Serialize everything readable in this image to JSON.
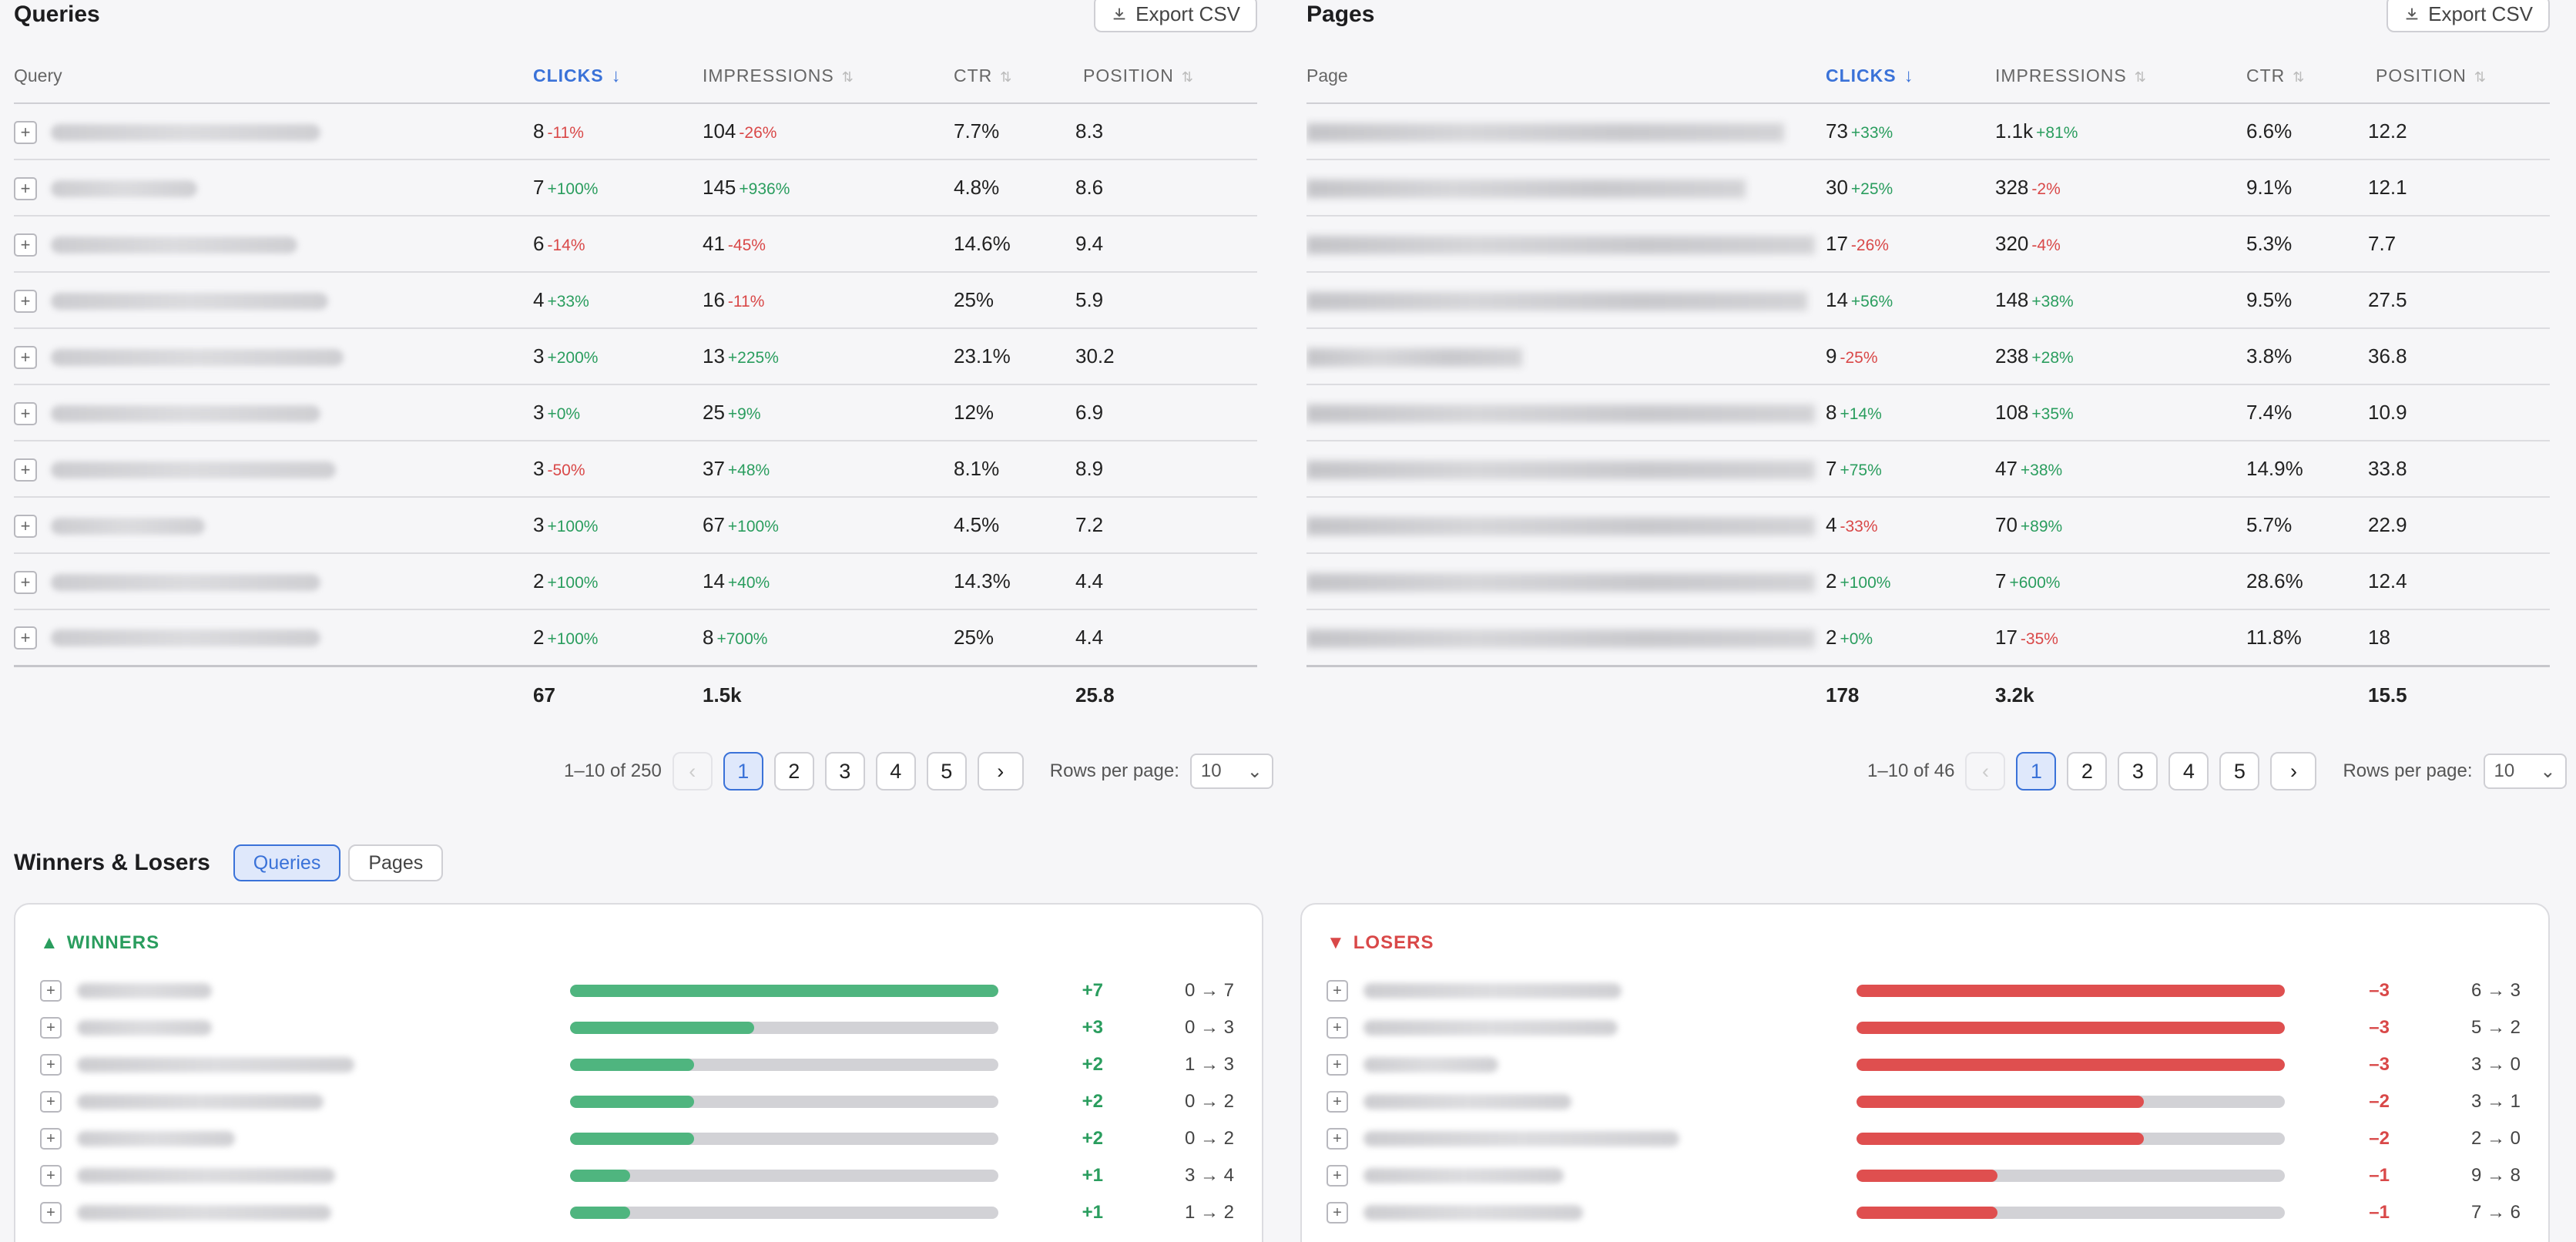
{
  "queries": {
    "title": "Queries",
    "export_label": "Export CSV",
    "columns": {
      "first": "Query",
      "clicks": "CLICKS",
      "impressions": "IMPRESSIONS",
      "ctr": "CTR",
      "position": "POSITION"
    },
    "rows": [
      {
        "clicks": "8",
        "clicks_chg": "-11%",
        "clicks_dir": "down",
        "impr": "104",
        "impr_chg": "-26%",
        "impr_dir": "down",
        "ctr": "7.7%",
        "pos": "8.3"
      },
      {
        "clicks": "7",
        "clicks_chg": "+100%",
        "clicks_dir": "up",
        "impr": "145",
        "impr_chg": "+936%",
        "impr_dir": "up",
        "ctr": "4.8%",
        "pos": "8.6"
      },
      {
        "clicks": "6",
        "clicks_chg": "-14%",
        "clicks_dir": "down",
        "impr": "41",
        "impr_chg": "-45%",
        "impr_dir": "down",
        "ctr": "14.6%",
        "pos": "9.4"
      },
      {
        "clicks": "4",
        "clicks_chg": "+33%",
        "clicks_dir": "up",
        "impr": "16",
        "impr_chg": "-11%",
        "impr_dir": "down",
        "ctr": "25%",
        "pos": "5.9"
      },
      {
        "clicks": "3",
        "clicks_chg": "+200%",
        "clicks_dir": "up",
        "impr": "13",
        "impr_chg": "+225%",
        "impr_dir": "up",
        "ctr": "23.1%",
        "pos": "30.2"
      },
      {
        "clicks": "3",
        "clicks_chg": "+0%",
        "clicks_dir": "up",
        "impr": "25",
        "impr_chg": "+9%",
        "impr_dir": "up",
        "ctr": "12%",
        "pos": "6.9"
      },
      {
        "clicks": "3",
        "clicks_chg": "-50%",
        "clicks_dir": "down",
        "impr": "37",
        "impr_chg": "+48%",
        "impr_dir": "up",
        "ctr": "8.1%",
        "pos": "8.9"
      },
      {
        "clicks": "3",
        "clicks_chg": "+100%",
        "clicks_dir": "up",
        "impr": "67",
        "impr_chg": "+100%",
        "impr_dir": "up",
        "ctr": "4.5%",
        "pos": "7.2"
      },
      {
        "clicks": "2",
        "clicks_chg": "+100%",
        "clicks_dir": "up",
        "impr": "14",
        "impr_chg": "+40%",
        "impr_dir": "up",
        "ctr": "14.3%",
        "pos": "4.4"
      },
      {
        "clicks": "2",
        "clicks_chg": "+100%",
        "clicks_dir": "up",
        "impr": "8",
        "impr_chg": "+700%",
        "impr_dir": "up",
        "ctr": "25%",
        "pos": "4.4"
      }
    ],
    "totals": {
      "clicks": "67",
      "impr": "1.5k",
      "pos": "25.8"
    },
    "pagination": {
      "range": "1–10 of 250",
      "pages": [
        "1",
        "2",
        "3",
        "4",
        "5"
      ],
      "rows_label": "Rows per page:",
      "rows_value": "10"
    }
  },
  "pages": {
    "title": "Pages",
    "export_label": "Export CSV",
    "columns": {
      "first": "Page",
      "clicks": "CLICKS",
      "impressions": "IMPRESSIONS",
      "ctr": "CTR",
      "position": "POSITION"
    },
    "rows": [
      {
        "clicks": "73",
        "clicks_chg": "+33%",
        "clicks_dir": "up",
        "impr": "1.1k",
        "impr_chg": "+81%",
        "impr_dir": "up",
        "ctr": "6.6%",
        "pos": "12.2"
      },
      {
        "clicks": "30",
        "clicks_chg": "+25%",
        "clicks_dir": "up",
        "impr": "328",
        "impr_chg": "-2%",
        "impr_dir": "down",
        "ctr": "9.1%",
        "pos": "12.1"
      },
      {
        "clicks": "17",
        "clicks_chg": "-26%",
        "clicks_dir": "down",
        "impr": "320",
        "impr_chg": "-4%",
        "impr_dir": "down",
        "ctr": "5.3%",
        "pos": "7.7"
      },
      {
        "clicks": "14",
        "clicks_chg": "+56%",
        "clicks_dir": "up",
        "impr": "148",
        "impr_chg": "+38%",
        "impr_dir": "up",
        "ctr": "9.5%",
        "pos": "27.5"
      },
      {
        "clicks": "9",
        "clicks_chg": "-25%",
        "clicks_dir": "down",
        "impr": "238",
        "impr_chg": "+28%",
        "impr_dir": "up",
        "ctr": "3.8%",
        "pos": "36.8"
      },
      {
        "clicks": "8",
        "clicks_chg": "+14%",
        "clicks_dir": "up",
        "impr": "108",
        "impr_chg": "+35%",
        "impr_dir": "up",
        "ctr": "7.4%",
        "pos": "10.9"
      },
      {
        "clicks": "7",
        "clicks_chg": "+75%",
        "clicks_dir": "up",
        "impr": "47",
        "impr_chg": "+38%",
        "impr_dir": "up",
        "ctr": "14.9%",
        "pos": "33.8"
      },
      {
        "clicks": "4",
        "clicks_chg": "-33%",
        "clicks_dir": "down",
        "impr": "70",
        "impr_chg": "+89%",
        "impr_dir": "up",
        "ctr": "5.7%",
        "pos": "22.9"
      },
      {
        "clicks": "2",
        "clicks_chg": "+100%",
        "clicks_dir": "up",
        "impr": "7",
        "impr_chg": "+600%",
        "impr_dir": "up",
        "ctr": "28.6%",
        "pos": "12.4"
      },
      {
        "clicks": "2",
        "clicks_chg": "+0%",
        "clicks_dir": "up",
        "impr": "17",
        "impr_chg": "-35%",
        "impr_dir": "down",
        "ctr": "11.8%",
        "pos": "18"
      }
    ],
    "totals": {
      "clicks": "178",
      "impr": "3.2k",
      "pos": "15.5"
    },
    "pagination": {
      "range": "1–10 of 46",
      "pages": [
        "1",
        "2",
        "3",
        "4",
        "5"
      ],
      "rows_label": "Rows per page:",
      "rows_value": "10"
    }
  },
  "winners_losers": {
    "title": "Winners & Losers",
    "tabs": [
      "Queries",
      "Pages"
    ],
    "active_tab": "Queries",
    "winners": {
      "label": "WINNERS",
      "rows": [
        {
          "delta": "+7",
          "fromto": "0 → 7",
          "fill": 1.0
        },
        {
          "delta": "+3",
          "fromto": "0 → 3",
          "fill": 0.43
        },
        {
          "delta": "+2",
          "fromto": "1 → 3",
          "fill": 0.29
        },
        {
          "delta": "+2",
          "fromto": "0 → 2",
          "fill": 0.29
        },
        {
          "delta": "+2",
          "fromto": "0 → 2",
          "fill": 0.29
        },
        {
          "delta": "+1",
          "fromto": "3 → 4",
          "fill": 0.14
        },
        {
          "delta": "+1",
          "fromto": "1 → 2",
          "fill": 0.14
        }
      ]
    },
    "losers": {
      "label": "LOSERS",
      "rows": [
        {
          "delta": "–3",
          "fromto": "6 → 3",
          "fill": 1.0
        },
        {
          "delta": "–3",
          "fromto": "5 → 2",
          "fill": 1.0
        },
        {
          "delta": "–3",
          "fromto": "3 → 0",
          "fill": 1.0
        },
        {
          "delta": "–2",
          "fromto": "3 → 1",
          "fill": 0.67
        },
        {
          "delta": "–2",
          "fromto": "2 → 0",
          "fill": 0.67
        },
        {
          "delta": "–1",
          "fromto": "9 → 8",
          "fill": 0.33
        },
        {
          "delta": "–1",
          "fromto": "7 → 6",
          "fill": 0.33
        }
      ]
    }
  },
  "colors": {
    "accent": "#3a72d8",
    "positive": "#2a9d5e",
    "negative": "#d94848"
  },
  "icons": {
    "export": "download-icon",
    "expand": "plus-icon",
    "sort_active": "arrow-down-icon",
    "sort": "sort-icon",
    "winners": "triangle-up-icon",
    "losers": "triangle-down-icon"
  }
}
